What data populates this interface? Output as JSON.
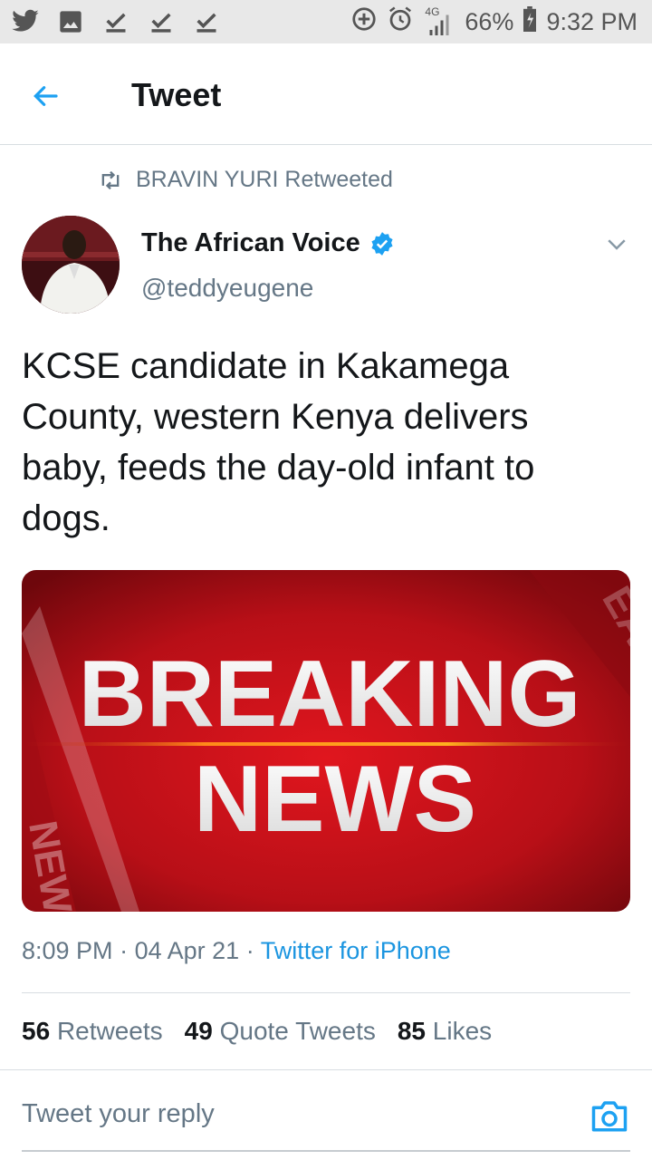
{
  "status_bar": {
    "network": "4G",
    "battery": "66%",
    "time": "9:32 PM",
    "left_icons": [
      "twitter-icon",
      "gallery-icon",
      "download-done-icon",
      "download-done-icon",
      "download-done-icon"
    ],
    "right_icons": [
      "data-saver-icon",
      "alarm-icon",
      "signal-icon",
      "battery-icon"
    ]
  },
  "header": {
    "title": "Tweet"
  },
  "tweet": {
    "retweeted_by": "BRAVIN YURI Retweeted",
    "author_name": "The African Voice",
    "author_handle": "@teddyeugene",
    "verified": true,
    "text": "KCSE candidate in Kakamega County, western Kenya delivers baby, feeds the day-old infant to dogs.",
    "media": {
      "line1": "BREAKING",
      "line2": "NEWS",
      "watermark_top": "EAKIN",
      "watermark_bottom": "NEWS"
    },
    "time": "8:09 PM",
    "date": "04 Apr 21",
    "source": "Twitter for iPhone"
  },
  "stats": {
    "retweets_count": "56",
    "retweets_label": "Retweets",
    "quotes_count": "49",
    "quotes_label": "Quote Tweets",
    "likes_count": "85",
    "likes_label": "Likes"
  },
  "reply": {
    "placeholder": "Tweet your reply"
  },
  "colors": {
    "accent": "#1da1f2",
    "text_primary": "#14171a",
    "text_secondary": "#657786",
    "breaking_red": "#c8141c"
  }
}
